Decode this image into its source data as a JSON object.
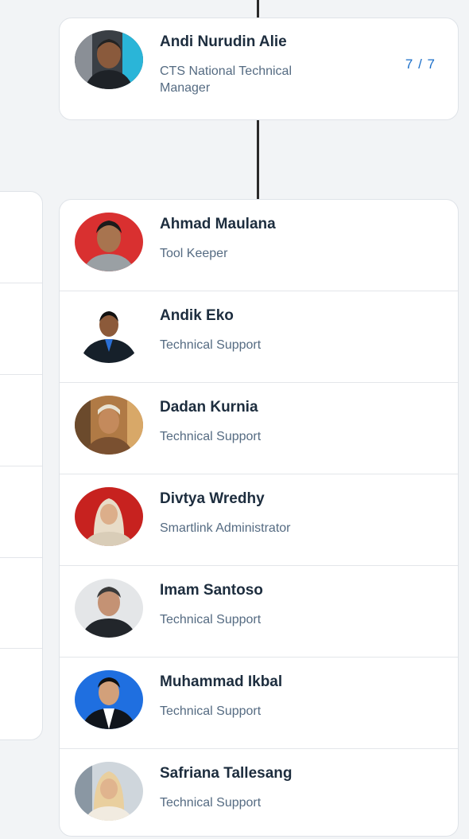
{
  "manager": {
    "name": "Andi Nurudin Alie",
    "role": "CTS National Technical Manager",
    "role_line1": "CTS National Technical",
    "role_line2": "Manager",
    "count": "7 / 7"
  },
  "team": [
    {
      "name": "Ahmad Maulana",
      "role": "Tool Keeper"
    },
    {
      "name": "Andik Eko",
      "role": "Technical Support"
    },
    {
      "name": "Dadan Kurnia",
      "role": "Technical Support"
    },
    {
      "name": "Divtya Wredhy",
      "role": "Smartlink Administrator"
    },
    {
      "name": "Imam Santoso",
      "role": "Technical Support"
    },
    {
      "name": "Muhammad Ikbal",
      "role": "Technical Support"
    },
    {
      "name": "Safriana Tallesang",
      "role": "Technical Support"
    }
  ],
  "colors": {
    "accent": "#1a6ec9",
    "name_text": "#1d2d3e",
    "role_text": "#556b82",
    "background": "#f2f4f6"
  }
}
